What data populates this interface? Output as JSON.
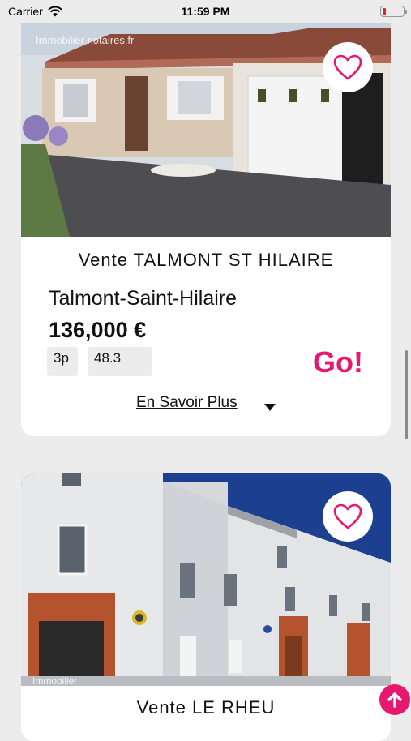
{
  "status_bar": {
    "carrier": "Carrier",
    "time": "11:59 PM"
  },
  "listings": [
    {
      "title": "Vente TALMONT ST HILAIRE",
      "city": "Talmont-Saint-Hilaire",
      "price": "136,000 €",
      "rooms": "3p",
      "surface": "48.3",
      "go_label": "Go!",
      "more_label": "En Savoir Plus",
      "watermark": "Immobilier notaires.fr"
    },
    {
      "title": "Vente LE RHEU",
      "watermark": "Immobilier"
    }
  ],
  "colors": {
    "accent": "#e6186f",
    "background": "#ececec",
    "card": "#ffffff"
  },
  "icons": {
    "favorite": "heart-icon",
    "expand": "chevron-down-icon",
    "scroll_top": "arrow-up-icon",
    "wifi": "wifi-icon",
    "battery": "battery-icon"
  }
}
